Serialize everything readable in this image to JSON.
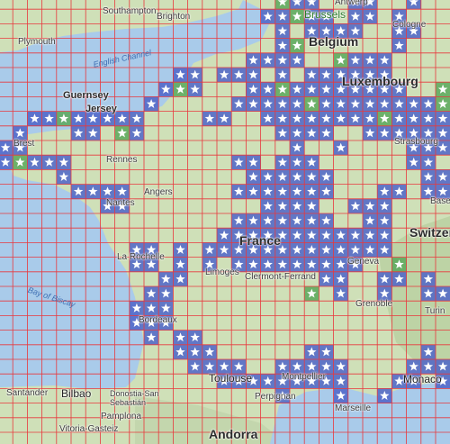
{
  "labels": {
    "southampton": "Southampton",
    "brighton": "Brighton",
    "antwerp": "Antwerp",
    "brussels": "Brussels",
    "belgium": "Belgium",
    "cologne": "Cologne",
    "plymouth": "Plymouth",
    "english_channel": "English Channel",
    "luxembourg": "Luxembourg",
    "guernsey": "Guernsey",
    "jersey": "Jersey",
    "brest": "Brest",
    "rennes": "Rennes",
    "strasbourg": "Strasbourg",
    "nantes": "Nantes",
    "angers": "Angers",
    "basel": "Basel",
    "switzerland": "Switzerland",
    "france": "France",
    "la_rochelle": "La Rochelle",
    "geneva": "Geneva",
    "bay_of_biscay": "Bay of Biscay",
    "limoges": "Limoges",
    "clermont": "Clermont-Ferrand",
    "grenoble": "Grenoble",
    "turin": "Turin",
    "bordeaux": "Bordeaux",
    "toulouse": "Toulouse",
    "montpellier": "Montpellier",
    "monaco": "Monaco",
    "marseille": "Marseille",
    "santander": "Santander",
    "bilbao": "Bilbao",
    "donostia": "Donostia-San Sebastián",
    "pamplona": "Pamplona",
    "vitoria": "Vitoria-Gasteiz",
    "andorra": "Andorra",
    "perpignan": "Perpignan"
  },
  "colors": {
    "sea": "#a9cbea",
    "land": "#cfe0b8",
    "grid": "#e8383d",
    "cell_blue": "#4e64c8",
    "cell_green": "#5aa85a",
    "star": "#ffffff"
  },
  "grid": {
    "cols": 31,
    "rows": 30
  },
  "marked_cells": [
    [
      19,
      0,
      "g"
    ],
    [
      20,
      0,
      "b"
    ],
    [
      21,
      0,
      "b"
    ],
    [
      24,
      0,
      "b"
    ],
    [
      25,
      0,
      "b"
    ],
    [
      28,
      0,
      "b"
    ],
    [
      18,
      1,
      "b"
    ],
    [
      19,
      1,
      "b"
    ],
    [
      20,
      1,
      "g"
    ],
    [
      21,
      1,
      "b"
    ],
    [
      22,
      1,
      "b"
    ],
    [
      24,
      1,
      "b"
    ],
    [
      25,
      1,
      "b"
    ],
    [
      27,
      1,
      "b"
    ],
    [
      19,
      2,
      "b"
    ],
    [
      21,
      2,
      "b"
    ],
    [
      22,
      2,
      "b"
    ],
    [
      23,
      2,
      "b"
    ],
    [
      24,
      2,
      "b"
    ],
    [
      27,
      2,
      "b"
    ],
    [
      28,
      2,
      "b"
    ],
    [
      19,
      3,
      "b"
    ],
    [
      20,
      3,
      "g"
    ],
    [
      27,
      3,
      "b"
    ],
    [
      17,
      4,
      "b"
    ],
    [
      18,
      4,
      "b"
    ],
    [
      19,
      4,
      "b"
    ],
    [
      20,
      4,
      "b"
    ],
    [
      23,
      4,
      "g"
    ],
    [
      24,
      4,
      "b"
    ],
    [
      25,
      4,
      "b"
    ],
    [
      26,
      4,
      "b"
    ],
    [
      12,
      5,
      "b"
    ],
    [
      13,
      5,
      "b"
    ],
    [
      15,
      5,
      "b"
    ],
    [
      16,
      5,
      "b"
    ],
    [
      17,
      5,
      "b"
    ],
    [
      19,
      5,
      "b"
    ],
    [
      21,
      5,
      "b"
    ],
    [
      22,
      5,
      "b"
    ],
    [
      23,
      5,
      "b"
    ],
    [
      24,
      5,
      "b"
    ],
    [
      25,
      5,
      "b"
    ],
    [
      26,
      5,
      "b"
    ],
    [
      11,
      6,
      "b"
    ],
    [
      12,
      6,
      "g"
    ],
    [
      13,
      6,
      "b"
    ],
    [
      17,
      6,
      "b"
    ],
    [
      18,
      6,
      "b"
    ],
    [
      19,
      6,
      "g"
    ],
    [
      20,
      6,
      "b"
    ],
    [
      21,
      6,
      "b"
    ],
    [
      22,
      6,
      "b"
    ],
    [
      23,
      6,
      "b"
    ],
    [
      24,
      6,
      "b"
    ],
    [
      25,
      6,
      "b"
    ],
    [
      26,
      6,
      "b"
    ],
    [
      27,
      6,
      "b"
    ],
    [
      30,
      6,
      "g"
    ],
    [
      10,
      7,
      "b"
    ],
    [
      16,
      7,
      "b"
    ],
    [
      17,
      7,
      "b"
    ],
    [
      18,
      7,
      "b"
    ],
    [
      19,
      7,
      "b"
    ],
    [
      20,
      7,
      "b"
    ],
    [
      21,
      7,
      "g"
    ],
    [
      22,
      7,
      "b"
    ],
    [
      23,
      7,
      "b"
    ],
    [
      24,
      7,
      "b"
    ],
    [
      25,
      7,
      "b"
    ],
    [
      26,
      7,
      "b"
    ],
    [
      27,
      7,
      "b"
    ],
    [
      28,
      7,
      "b"
    ],
    [
      29,
      7,
      "b"
    ],
    [
      30,
      7,
      "g"
    ],
    [
      2,
      8,
      "b"
    ],
    [
      3,
      8,
      "b"
    ],
    [
      4,
      8,
      "g"
    ],
    [
      5,
      8,
      "b"
    ],
    [
      6,
      8,
      "b"
    ],
    [
      7,
      8,
      "b"
    ],
    [
      8,
      8,
      "b"
    ],
    [
      9,
      8,
      "b"
    ],
    [
      14,
      8,
      "b"
    ],
    [
      15,
      8,
      "b"
    ],
    [
      18,
      8,
      "b"
    ],
    [
      19,
      8,
      "b"
    ],
    [
      20,
      8,
      "b"
    ],
    [
      21,
      8,
      "b"
    ],
    [
      22,
      8,
      "b"
    ],
    [
      23,
      8,
      "b"
    ],
    [
      24,
      8,
      "b"
    ],
    [
      25,
      8,
      "b"
    ],
    [
      26,
      8,
      "g"
    ],
    [
      27,
      8,
      "b"
    ],
    [
      28,
      8,
      "b"
    ],
    [
      29,
      8,
      "b"
    ],
    [
      30,
      8,
      "b"
    ],
    [
      1,
      9,
      "b"
    ],
    [
      5,
      9,
      "b"
    ],
    [
      6,
      9,
      "b"
    ],
    [
      8,
      9,
      "g"
    ],
    [
      9,
      9,
      "b"
    ],
    [
      19,
      9,
      "b"
    ],
    [
      20,
      9,
      "b"
    ],
    [
      21,
      9,
      "b"
    ],
    [
      22,
      9,
      "b"
    ],
    [
      25,
      9,
      "b"
    ],
    [
      26,
      9,
      "b"
    ],
    [
      27,
      9,
      "b"
    ],
    [
      28,
      9,
      "b"
    ],
    [
      29,
      9,
      "b"
    ],
    [
      30,
      9,
      "b"
    ],
    [
      0,
      10,
      "b"
    ],
    [
      1,
      10,
      "b"
    ],
    [
      20,
      10,
      "b"
    ],
    [
      23,
      10,
      "b"
    ],
    [
      28,
      10,
      "b"
    ],
    [
      29,
      10,
      "b"
    ],
    [
      30,
      10,
      "b"
    ],
    [
      0,
      11,
      "b"
    ],
    [
      1,
      11,
      "g"
    ],
    [
      2,
      11,
      "b"
    ],
    [
      3,
      11,
      "b"
    ],
    [
      4,
      11,
      "b"
    ],
    [
      16,
      11,
      "b"
    ],
    [
      17,
      11,
      "b"
    ],
    [
      19,
      11,
      "b"
    ],
    [
      20,
      11,
      "b"
    ],
    [
      21,
      11,
      "b"
    ],
    [
      28,
      11,
      "b"
    ],
    [
      29,
      11,
      "b"
    ],
    [
      4,
      12,
      "b"
    ],
    [
      17,
      12,
      "b"
    ],
    [
      18,
      12,
      "b"
    ],
    [
      19,
      12,
      "b"
    ],
    [
      20,
      12,
      "b"
    ],
    [
      21,
      12,
      "b"
    ],
    [
      22,
      12,
      "b"
    ],
    [
      29,
      12,
      "b"
    ],
    [
      30,
      12,
      "b"
    ],
    [
      5,
      13,
      "b"
    ],
    [
      6,
      13,
      "b"
    ],
    [
      7,
      13,
      "b"
    ],
    [
      8,
      13,
      "b"
    ],
    [
      16,
      13,
      "b"
    ],
    [
      17,
      13,
      "b"
    ],
    [
      18,
      13,
      "b"
    ],
    [
      19,
      13,
      "b"
    ],
    [
      20,
      13,
      "b"
    ],
    [
      21,
      13,
      "b"
    ],
    [
      22,
      13,
      "b"
    ],
    [
      26,
      13,
      "b"
    ],
    [
      27,
      13,
      "b"
    ],
    [
      29,
      13,
      "b"
    ],
    [
      30,
      13,
      "b"
    ],
    [
      7,
      14,
      "b"
    ],
    [
      8,
      14,
      "b"
    ],
    [
      18,
      14,
      "b"
    ],
    [
      19,
      14,
      "b"
    ],
    [
      20,
      14,
      "b"
    ],
    [
      21,
      14,
      "b"
    ],
    [
      24,
      14,
      "b"
    ],
    [
      25,
      14,
      "b"
    ],
    [
      26,
      14,
      "b"
    ],
    [
      16,
      15,
      "b"
    ],
    [
      17,
      15,
      "b"
    ],
    [
      18,
      15,
      "b"
    ],
    [
      19,
      15,
      "b"
    ],
    [
      20,
      15,
      "b"
    ],
    [
      21,
      15,
      "b"
    ],
    [
      22,
      15,
      "b"
    ],
    [
      25,
      15,
      "b"
    ],
    [
      26,
      15,
      "b"
    ],
    [
      15,
      16,
      "b"
    ],
    [
      16,
      16,
      "b"
    ],
    [
      17,
      16,
      "b"
    ],
    [
      18,
      16,
      "b"
    ],
    [
      19,
      16,
      "b"
    ],
    [
      20,
      16,
      "b"
    ],
    [
      21,
      16,
      "b"
    ],
    [
      22,
      16,
      "b"
    ],
    [
      23,
      16,
      "b"
    ],
    [
      24,
      16,
      "b"
    ],
    [
      25,
      16,
      "b"
    ],
    [
      26,
      16,
      "b"
    ],
    [
      9,
      17,
      "b"
    ],
    [
      10,
      17,
      "b"
    ],
    [
      12,
      17,
      "b"
    ],
    [
      14,
      17,
      "b"
    ],
    [
      15,
      17,
      "b"
    ],
    [
      16,
      17,
      "b"
    ],
    [
      17,
      17,
      "b"
    ],
    [
      18,
      17,
      "b"
    ],
    [
      19,
      17,
      "b"
    ],
    [
      20,
      17,
      "b"
    ],
    [
      21,
      17,
      "b"
    ],
    [
      22,
      17,
      "b"
    ],
    [
      23,
      17,
      "b"
    ],
    [
      24,
      17,
      "b"
    ],
    [
      25,
      17,
      "b"
    ],
    [
      26,
      17,
      "b"
    ],
    [
      9,
      18,
      "b"
    ],
    [
      10,
      18,
      "b"
    ],
    [
      12,
      18,
      "b"
    ],
    [
      14,
      18,
      "b"
    ],
    [
      16,
      18,
      "b"
    ],
    [
      17,
      18,
      "b"
    ],
    [
      18,
      18,
      "b"
    ],
    [
      19,
      18,
      "b"
    ],
    [
      20,
      18,
      "b"
    ],
    [
      21,
      18,
      "b"
    ],
    [
      22,
      18,
      "b"
    ],
    [
      23,
      18,
      "b"
    ],
    [
      24,
      18,
      "b"
    ],
    [
      27,
      18,
      "g"
    ],
    [
      11,
      19,
      "b"
    ],
    [
      12,
      19,
      "b"
    ],
    [
      22,
      19,
      "b"
    ],
    [
      23,
      19,
      "b"
    ],
    [
      26,
      19,
      "b"
    ],
    [
      27,
      19,
      "b"
    ],
    [
      29,
      19,
      "b"
    ],
    [
      10,
      20,
      "b"
    ],
    [
      11,
      20,
      "b"
    ],
    [
      21,
      20,
      "g"
    ],
    [
      23,
      20,
      "b"
    ],
    [
      26,
      20,
      "b"
    ],
    [
      29,
      20,
      "b"
    ],
    [
      30,
      20,
      "b"
    ],
    [
      9,
      21,
      "b"
    ],
    [
      10,
      21,
      "b"
    ],
    [
      11,
      21,
      "b"
    ],
    [
      9,
      22,
      "b"
    ],
    [
      10,
      22,
      "b"
    ],
    [
      11,
      22,
      "b"
    ],
    [
      10,
      23,
      "b"
    ],
    [
      12,
      23,
      "b"
    ],
    [
      13,
      23,
      "b"
    ],
    [
      12,
      24,
      "b"
    ],
    [
      13,
      24,
      "b"
    ],
    [
      14,
      24,
      "b"
    ],
    [
      21,
      24,
      "b"
    ],
    [
      22,
      24,
      "b"
    ],
    [
      29,
      24,
      "b"
    ],
    [
      13,
      25,
      "b"
    ],
    [
      14,
      25,
      "b"
    ],
    [
      15,
      25,
      "b"
    ],
    [
      16,
      25,
      "b"
    ],
    [
      19,
      25,
      "b"
    ],
    [
      20,
      25,
      "b"
    ],
    [
      21,
      25,
      "b"
    ],
    [
      22,
      25,
      "b"
    ],
    [
      23,
      25,
      "b"
    ],
    [
      28,
      25,
      "b"
    ],
    [
      29,
      25,
      "b"
    ],
    [
      30,
      25,
      "b"
    ],
    [
      15,
      26,
      "b"
    ],
    [
      16,
      26,
      "b"
    ],
    [
      17,
      26,
      "b"
    ],
    [
      18,
      26,
      "b"
    ],
    [
      19,
      26,
      "b"
    ],
    [
      20,
      26,
      "b"
    ],
    [
      21,
      26,
      "b"
    ],
    [
      22,
      26,
      "b"
    ],
    [
      23,
      26,
      "b"
    ],
    [
      27,
      26,
      "b"
    ],
    [
      28,
      26,
      "b"
    ],
    [
      30,
      26,
      "b"
    ],
    [
      19,
      27,
      "b"
    ],
    [
      23,
      27,
      "b"
    ],
    [
      26,
      27,
      "b"
    ]
  ]
}
